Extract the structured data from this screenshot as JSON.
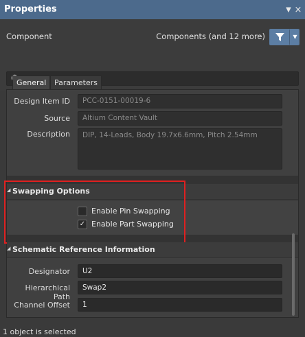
{
  "window": {
    "title": "Properties"
  },
  "header": {
    "component_label": "Component",
    "filter_text": "Components (and 12 more)"
  },
  "search": {
    "placeholder": "Search"
  },
  "tabs": [
    {
      "label": "General",
      "active": true
    },
    {
      "label": "Parameters",
      "active": false
    }
  ],
  "general": {
    "design_item_id": {
      "label": "Design Item ID",
      "value": "PCC-0151-00019-6"
    },
    "source": {
      "label": "Source",
      "value": "Altium Content Vault"
    },
    "description": {
      "label": "Description",
      "value": "DIP, 14-Leads, Body 19.7x6.6mm, Pitch 2.54mm"
    }
  },
  "swapping": {
    "title": "Swapping Options",
    "pin_swapping": {
      "label": "Enable Pin Swapping",
      "checked": false
    },
    "part_swapping": {
      "label": "Enable Part Swapping",
      "checked": true
    }
  },
  "schematic": {
    "title": "Schematic Reference Information",
    "designator": {
      "label": "Designator",
      "value": "U2"
    },
    "hierarchical_path": {
      "label": "Hierarchical Path",
      "value": "Swap2"
    },
    "channel_offset": {
      "label": "Channel Offset",
      "value": "1"
    }
  },
  "status": {
    "text": "1 object is selected"
  },
  "colors": {
    "titlebar": "#4c6a8c",
    "filter_button": "#5c7ea4",
    "highlight": "#e02020"
  }
}
